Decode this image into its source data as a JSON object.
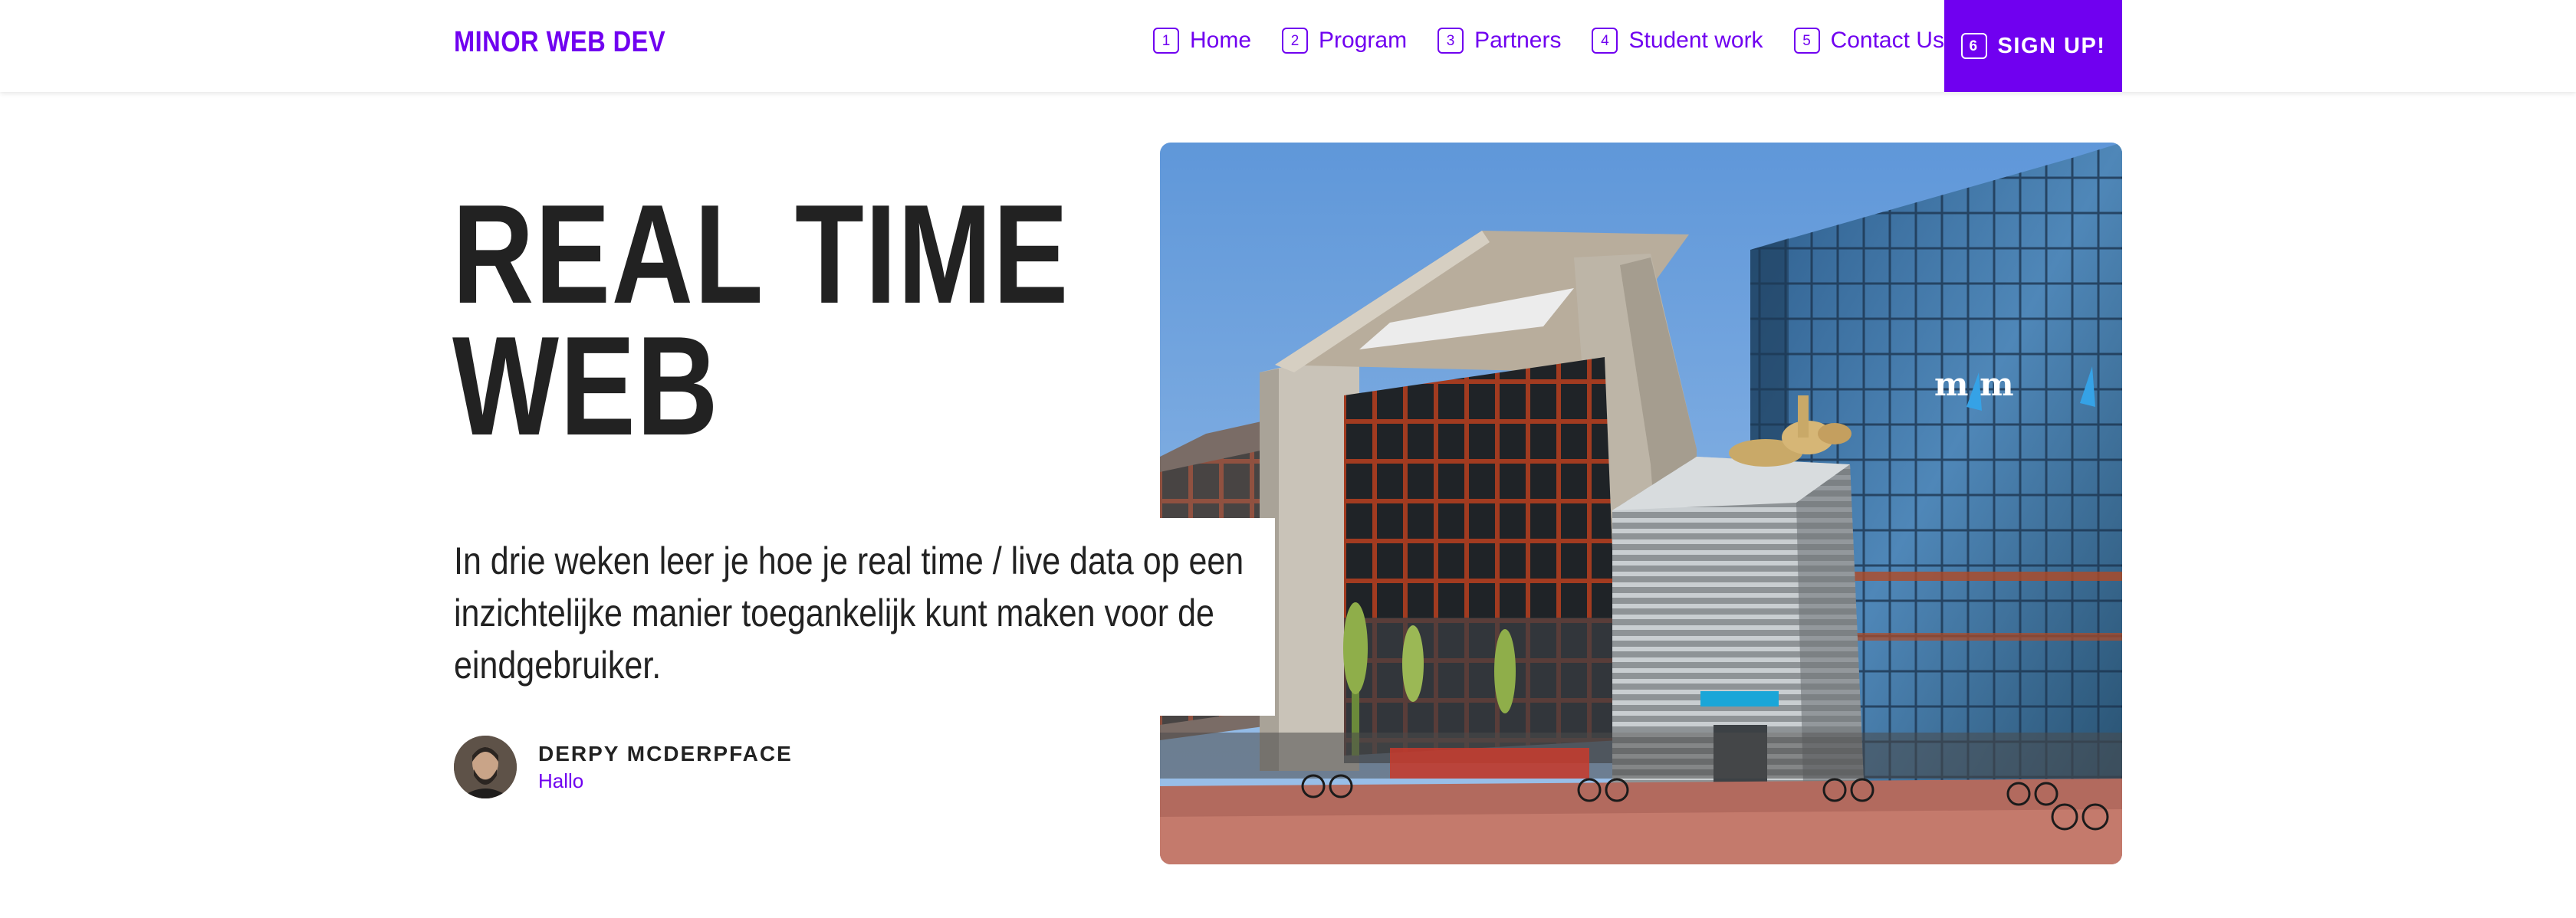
{
  "nav": {
    "brand": "MINOR WEB DEV",
    "items": [
      {
        "num": "1",
        "label": "Home"
      },
      {
        "num": "2",
        "label": "Program"
      },
      {
        "num": "3",
        "label": "Partners"
      },
      {
        "num": "4",
        "label": "Student work"
      },
      {
        "num": "5",
        "label": "Contact Us"
      }
    ],
    "cta": {
      "num": "6",
      "label": "SIGN UP!"
    }
  },
  "hero": {
    "title_line1": "REAL TIME",
    "title_line2": "WEB",
    "description": "In drie weken leer je hoe je real time / live data op een inzichtelijke manier toegankelijk kunt maken voor de eindgebruiker.",
    "author": {
      "name": "DERPY MCDERPFACE",
      "link": "Hallo"
    },
    "photo_logo": "m m"
  },
  "colors": {
    "accent": "#7000f0",
    "text": "#222222",
    "background": "#ffffff"
  }
}
